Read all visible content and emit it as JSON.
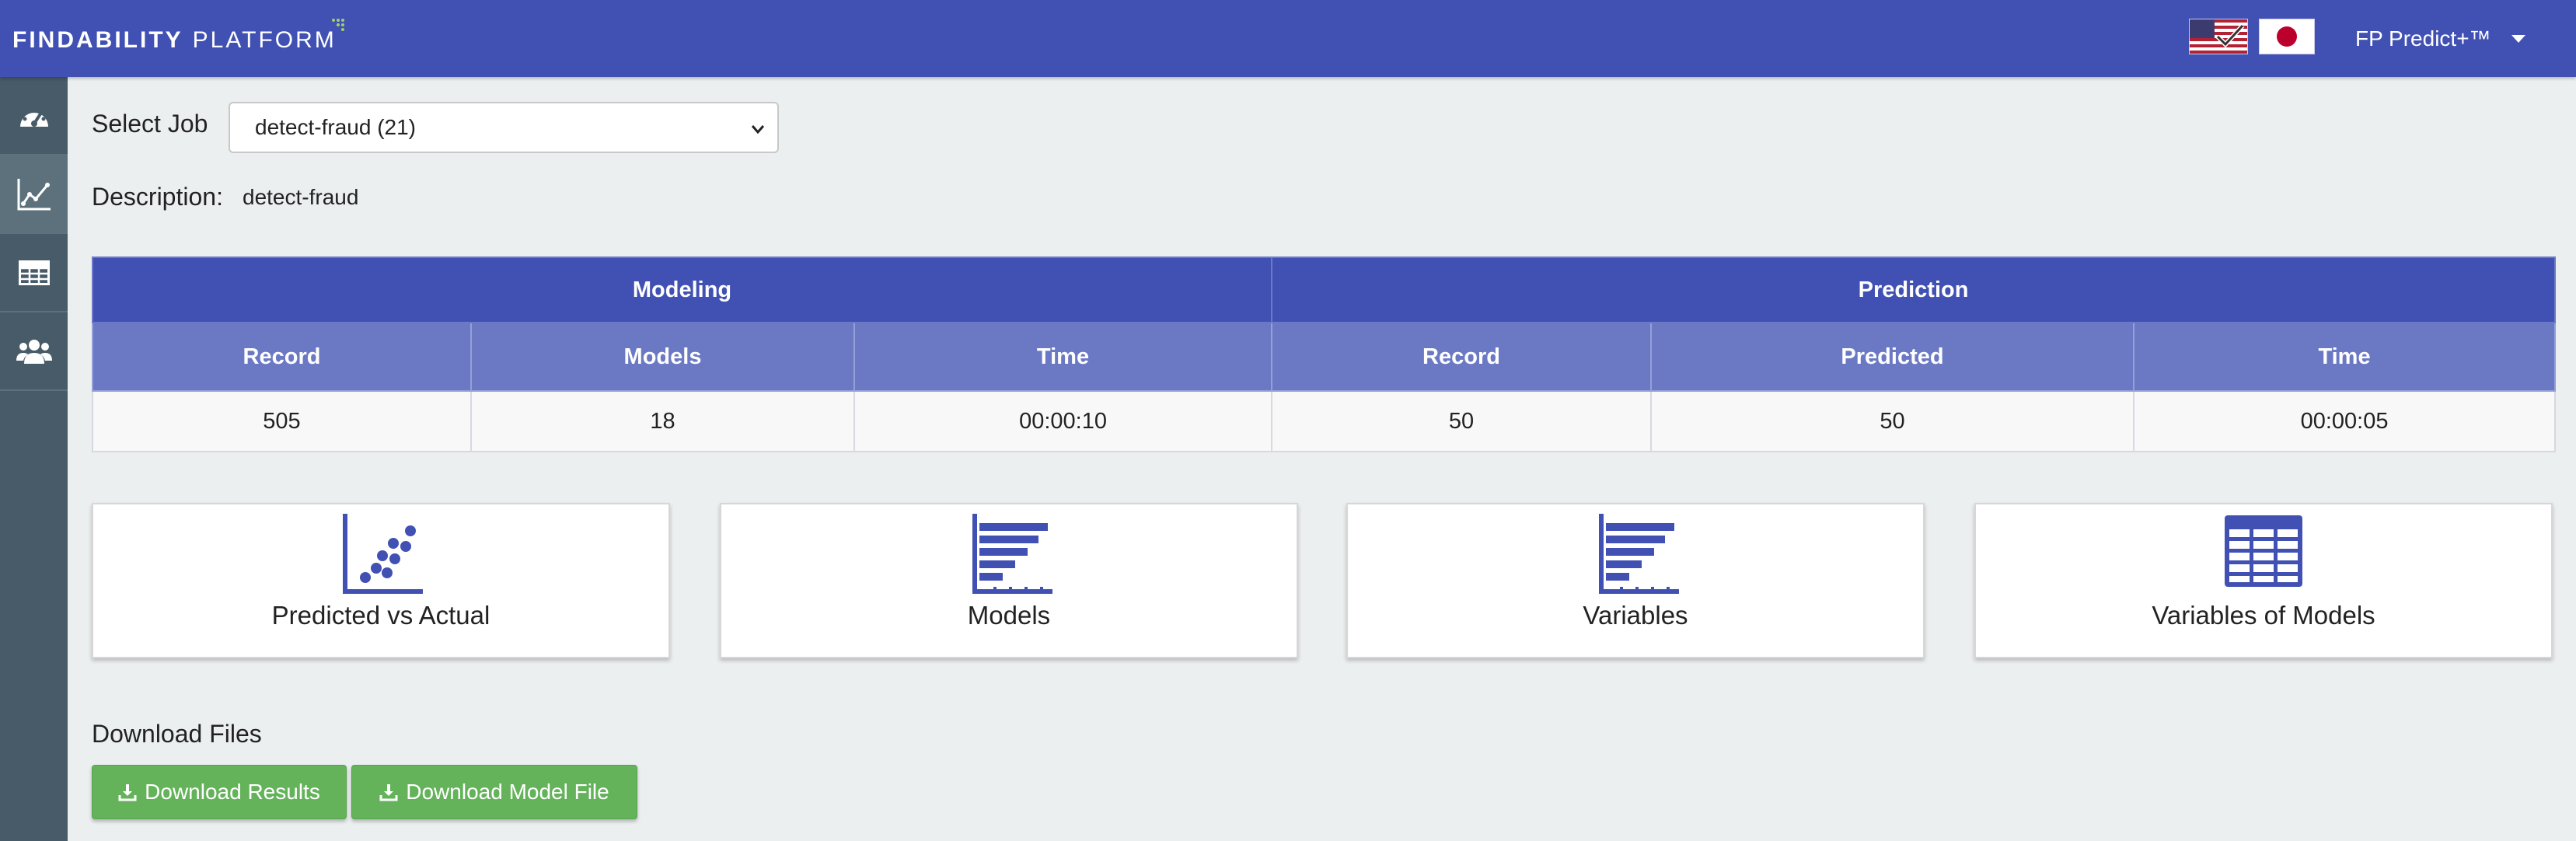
{
  "header": {
    "brand_primary": "FINDABILITY",
    "brand_secondary": "PLATFORM",
    "user_menu_label": "FP Predict+™",
    "colors": {
      "bar": "#4151b3"
    }
  },
  "sidebar": {
    "items": [
      {
        "icon": "dashboard-icon",
        "active": false
      },
      {
        "icon": "line-chart-icon",
        "active": true
      },
      {
        "icon": "table-icon",
        "active": false
      },
      {
        "icon": "users-icon",
        "active": false
      }
    ]
  },
  "job": {
    "select_label": "Select Job",
    "selected_value": "detect-fraud (21)",
    "description_label": "Description:",
    "description_value": "detect-fraud"
  },
  "stats": {
    "modeling_header": "Modeling",
    "prediction_header": "Prediction",
    "columns": [
      "Record",
      "Models",
      "Time",
      "Record",
      "Predicted",
      "Time"
    ],
    "values": [
      "505",
      "18",
      "00:00:10",
      "50",
      "50",
      "00:00:05"
    ]
  },
  "cards": [
    {
      "label": "Predicted vs Actual",
      "icon": "scatter-plot-icon"
    },
    {
      "label": "Models",
      "icon": "bar-chart-icon"
    },
    {
      "label": "Variables",
      "icon": "bar-chart-icon"
    },
    {
      "label": "Variables of Models",
      "icon": "table-grid-icon"
    }
  ],
  "downloads": {
    "section_title": "Download Files",
    "results_label": "Download Results",
    "model_file_label": "Download Model File",
    "color": "#64b35b"
  }
}
